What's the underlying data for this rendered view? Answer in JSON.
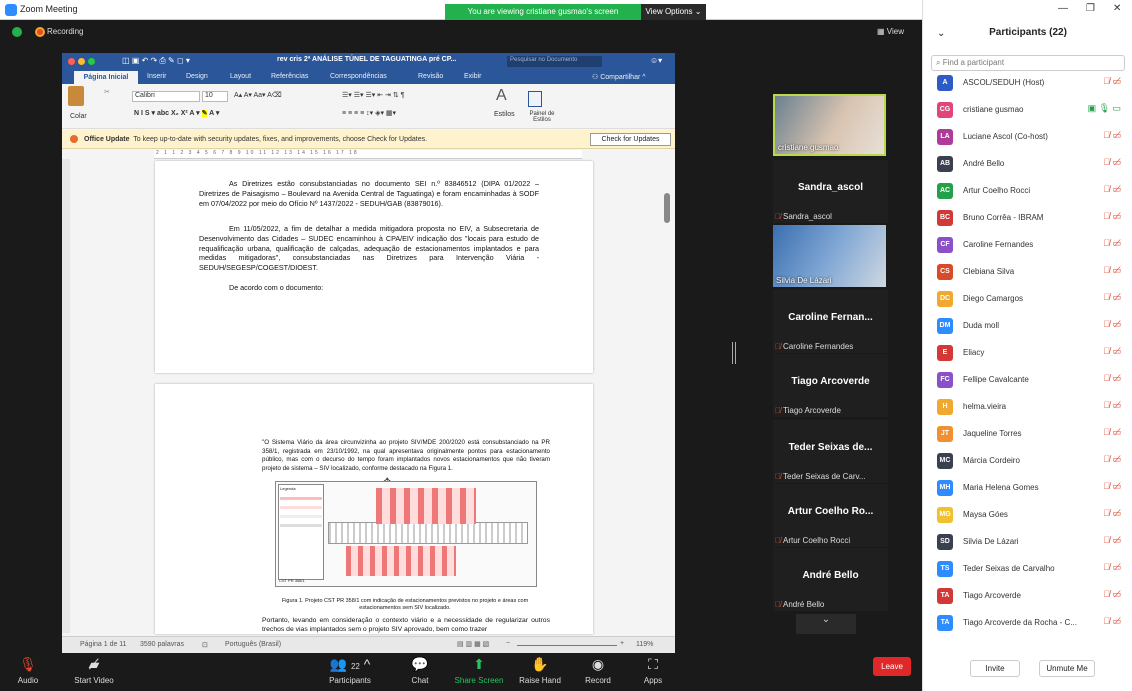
{
  "window": {
    "title": "Zoom Meeting",
    "banner": "You are viewing cristiane gusmao's screen",
    "view_options": "View Options",
    "recording": "Recording",
    "view_btn": "View"
  },
  "word": {
    "title": "rev cris 2ª ANÁLISE TÚNEL DE TAGUATINGA pré CP...",
    "search_placeholder": "Pesquisar no Documento",
    "tabs": [
      "Página Inicial",
      "Inserir",
      "Design",
      "Layout",
      "Referências",
      "Correspondências",
      "Revisão",
      "Exibir"
    ],
    "share": "Compartilhar",
    "paste_label": "Colar",
    "font": "Calibri",
    "size": "10",
    "styles": "Estilos",
    "styles_pane": "Painel de Estilos",
    "office_title": "Office Update",
    "office_text": "To keep up-to-date with security updates, fixes, and improvements, choose Check for Updates.",
    "check_btn": "Check for Updates",
    "ruler": "2 1 1 2 3 4 5 6 7 8 9 10 11 12 13 14 15 16 17 18",
    "p1": "As Diretrizes estão consubstanciadas no documento SEI n.º 83846512 (DIPA 01/2022 – Diretrizes de Paisagismo – Boulevard na Avenida Central de Taguatinga) e foram encaminhadas à SODF em 07/04/2022 por meio do Ofício Nº 1437/2022 - SEDUH/GAB (83879016).",
    "p2": "Em 11/05/2022, a fim de detalhar a medida mitigadora proposta no EIV, a Subsecretaria de Desenvolvimento das Cidades – SUDEC encaminhou à CPA/EIV indicação dos \"locais para estudo de requalificação urbana, qualificação de calçadas, adequação de estacionamentos implantados e para medidas mitigadoras\", consubstanciadas nas Diretrizes para Intervenção Viária - SEDUH/SEGESP/COGEST/DIOEST.",
    "p3": "De acordo com o documento:",
    "q1": "\"O Sistema Viário da área circunvizinha ao projeto SIV/MDE 200/2020 está consubstanciado na PR 358/1, registrada em 23/10/1992, na qual apresentava originalmente pontos para estacionamento público, mas com o decurso do tempo foram implantados novos estacionamentos que não tiveram projeto de sistema – SIV localizado, conforme destacado na Figura 1.",
    "caption": "Figura 1. Projeto CST PR 358/1 com indicação de estacionamentos previstos no projeto e áreas com estacionamentos sem SIV localizado.",
    "p4": "Portanto, levando em consideração o contexto viário e a necessidade de regularizar outros trechos de vias implantados sem o projeto SIV aprovado, bem como trazer",
    "legend_title": "Legenda",
    "figure_label": "CST PR 358/1",
    "status_page": "Página 1 de 11",
    "status_words": "3590 palavras",
    "status_lang": "Português (Brasil)",
    "zoom": "119%"
  },
  "gallery": {
    "tiles": [
      {
        "type": "video",
        "label": "cristiane gusmao"
      },
      {
        "type": "name",
        "name": "Sandra_ascol",
        "label": "Sandra_ascol"
      },
      {
        "type": "video",
        "label": "Silvia De Lázari"
      },
      {
        "type": "name",
        "name": "Caroline Fernan...",
        "label": "Caroline Fernandes"
      },
      {
        "type": "name",
        "name": "Tiago Arcoverde",
        "label": "Tiago Arcoverde"
      },
      {
        "type": "name",
        "name": "Teder Seixas de...",
        "label": "Teder Seixas de Carv..."
      },
      {
        "type": "name",
        "name": "Artur Coelho Ro...",
        "label": "Artur Coelho Rocci"
      },
      {
        "type": "name",
        "name": "André Bello",
        "label": "André Bello"
      }
    ]
  },
  "toolbar": {
    "audio": "Audio",
    "video": "Start Video",
    "participants": "Participants",
    "participants_count": "22",
    "chat": "Chat",
    "share": "Share Screen",
    "raise": "Raise Hand",
    "record": "Record",
    "apps": "Apps",
    "leave": "Leave"
  },
  "panel": {
    "title": "Participants (22)",
    "search": "Find a participant",
    "invite": "Invite",
    "unmute": "Unmute Me",
    "participants": [
      {
        "initials": "A",
        "name": "ASCOL/SEDUH (Host)",
        "color": "#2d5cc9"
      },
      {
        "initials": "CG",
        "name": "cristiane gusmao",
        "color": "#e0457b"
      },
      {
        "initials": "LA",
        "name": "Luciane Ascol (Co-host)",
        "color": "#b03a9a"
      },
      {
        "initials": "AB",
        "name": "André Bello",
        "color": "#3a4050"
      },
      {
        "initials": "AC",
        "name": "Artur Coelho Rocci",
        "color": "#22a04a"
      },
      {
        "initials": "BC",
        "name": "Bruno Corrêa - IBRAM",
        "color": "#d23838"
      },
      {
        "initials": "CF",
        "name": "Caroline Fernandes",
        "color": "#8a4fc9"
      },
      {
        "initials": "CS",
        "name": "Clebiana Silva",
        "color": "#d94a2a"
      },
      {
        "initials": "DC",
        "name": "Diego Camargos",
        "color": "#f0a830"
      },
      {
        "initials": "DM",
        "name": "Duda moll",
        "color": "#2d8cff"
      },
      {
        "initials": "E",
        "name": "Eliacy",
        "color": "#d23838"
      },
      {
        "initials": "FC",
        "name": "Fellipe Cavalcante",
        "color": "#8a4fc9"
      },
      {
        "initials": "H",
        "name": "helma.vieira",
        "color": "#f0a830"
      },
      {
        "initials": "JT",
        "name": "Jaqueline Torres",
        "color": "#f09030"
      },
      {
        "initials": "MC",
        "name": "Márcia Cordeiro",
        "color": "#3a4050"
      },
      {
        "initials": "MH",
        "name": "Maria Helena Gomes",
        "color": "#2d8cff"
      },
      {
        "initials": "MG",
        "name": "Maysa Góes",
        "color": "#f0c030"
      },
      {
        "initials": "SD",
        "name": "Silvia De Lázari",
        "color": "#3a4050"
      },
      {
        "initials": "TS",
        "name": "Teder Seixas de Carvalho",
        "color": "#2d8cff"
      },
      {
        "initials": "TA",
        "name": "Tiago Arcoverde",
        "color": "#d23838"
      },
      {
        "initials": "TA",
        "name": "Tiago Arcoverde da Rocha - C...",
        "color": "#2d8cff"
      }
    ]
  }
}
